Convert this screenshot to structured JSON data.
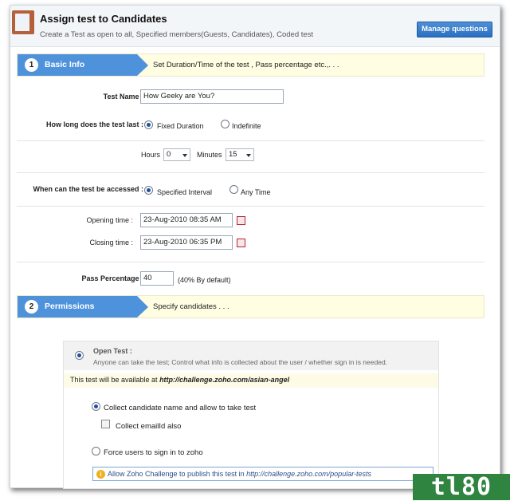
{
  "header": {
    "title": "Assign test to Candidates",
    "subtitle": "Create a Test as open to all, Specified members(Guests, Candidates), Coded test",
    "manage_button": "Manage questions"
  },
  "step1": {
    "number": "1",
    "name": "Basic Info",
    "description": "Set Duration/Time of the test , Pass percentage etc.,. . ."
  },
  "form": {
    "test_name_label": "Test Name :",
    "test_name_value": "How Geeky are You?",
    "duration_label": "How long does the test last :",
    "duration_options": [
      "Fixed Duration",
      "Indefinite"
    ],
    "duration_selected": "Fixed Duration",
    "hours_label": "Hours",
    "hours_value": "0",
    "minutes_label": "Minutes",
    "minutes_value": "15",
    "access_label": "When can the test be accessed :",
    "access_options": [
      "Specified Interval",
      "Any Time"
    ],
    "access_selected": "Specified Interval",
    "opening_label": "Opening time :",
    "opening_value": "23-Aug-2010 08:35 AM",
    "closing_label": "Closing time :",
    "closing_value": "23-Aug-2010 06:35 PM",
    "pass_label": "Pass Percentage :",
    "pass_value": "40",
    "pass_hint": "(40% By default)"
  },
  "step2": {
    "number": "2",
    "name": "Permissions",
    "description": "Specify candidates . . ."
  },
  "permissions": {
    "open_test_title": "Open Test :",
    "open_test_desc": "Anyone can take the test; Control what info is collected about the user / whether sign in is needed.",
    "availability_prefix": "This test will be available at ",
    "availability_url": "http://challenge.zoho.com/asian-angel",
    "collect_name": "Collect candidate name and allow to take test",
    "collect_email": "Collect emailId also",
    "force_signin": "Force users to sign in to zoho",
    "publish_text": "Allow Zoho Challenge to publish this test in ",
    "publish_url": "http://challenge.zoho.com/popular-tests"
  },
  "watermark": "tl80"
}
